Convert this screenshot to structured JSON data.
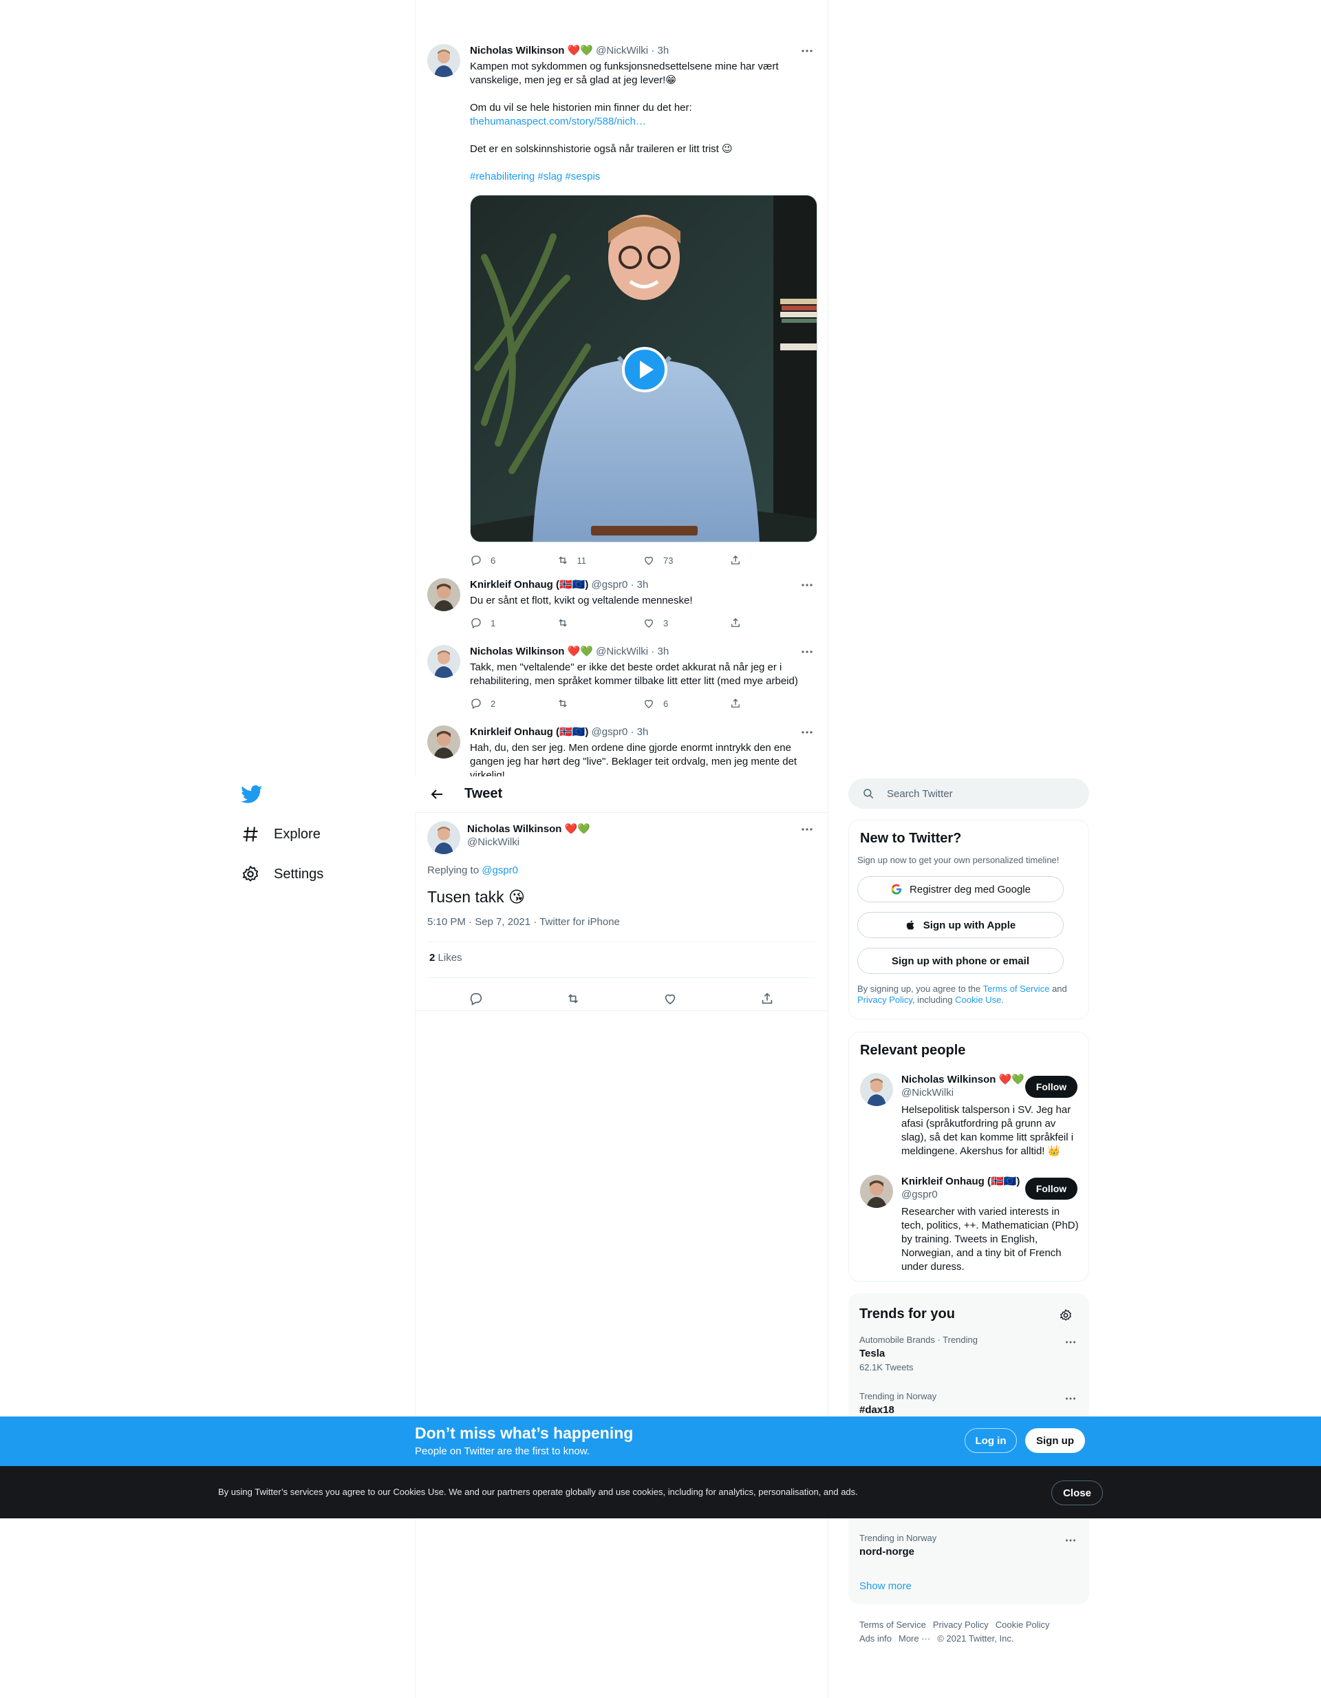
{
  "nav": {
    "explore_label": "Explore",
    "settings_label": "Settings"
  },
  "thread": [
    {
      "name": "Nicholas Wilkinson",
      "badges": "❤️💚",
      "handle": "@NickWilki",
      "time": "· 3h",
      "lines": [
        "Kampen mot sykdommen og funksjonsnedsettelsene mine har vært vanskelige, men jeg er så glad at jeg lever!😁",
        "Om du vil se hele historien min finner du det her:",
        "Det er en solskinnshistorie også når traileren er litt trist 😉"
      ],
      "link": "thehumanaspect.com/story/588/nich…",
      "hashtags": "#rehabilitering #slag #sespis",
      "replies": "6",
      "retweets": "11",
      "likes": "73"
    },
    {
      "name": "Knirkleif Onhaug (🇳🇴🇪🇺)",
      "handle": "@gspr0",
      "time": "· 3h",
      "text": "Du er sånt et flott, kvikt og veltalende menneske!",
      "replies": "1",
      "retweets": "",
      "likes": "3"
    },
    {
      "name": "Nicholas Wilkinson",
      "badges": "❤️💚",
      "handle": "@NickWilki",
      "time": "· 3h",
      "text": "Takk, men \"veltalende\" er ikke det beste ordet akkurat nå når jeg er i rehabilitering, men språket kommer tilbake litt etter litt (med mye arbeid)",
      "replies": "2",
      "retweets": "",
      "likes": "6"
    },
    {
      "name": "Knirkleif Onhaug (🇳🇴🇪🇺)",
      "handle": "@gspr0",
      "time": "· 3h",
      "text": "Hah, du, den ser jeg. Men ordene dine gjorde enormt inntrykk den ene gangen jeg har hørt deg \"live\". Beklager teit ordvalg, men jeg mente det virkelig!"
    }
  ],
  "header": {
    "title": "Tweet"
  },
  "main_tweet": {
    "name": "Nicholas Wilkinson",
    "badges": "❤️💚",
    "handle": "@NickWilki",
    "replying_prefix": "Replying to",
    "replying_to": "@gspr0",
    "text": "Tusen takk 😘",
    "meta": "5:10 PM · Sep 7, 2021 · Twitter for iPhone",
    "likes_count": "2",
    "likes_label": "Likes"
  },
  "search": {
    "placeholder": "Search Twitter"
  },
  "new_to_twitter": {
    "title": "New to Twitter?",
    "subtitle": "Sign up now to get your own personalized timeline!",
    "google_label": "Registrer deg med Google",
    "apple_label": "Sign up with Apple",
    "phone_label": "Sign up with phone or email",
    "legal_prefix": "By signing up, you agree to the",
    "terms": "Terms of Service",
    "and": "and",
    "privacy": "Privacy Policy",
    "including": ", including",
    "cookie": "Cookie Use."
  },
  "relevant_people": {
    "title": "Relevant people",
    "people": [
      {
        "name": "Nicholas Wilkinson ❤️💚",
        "handle": "@NickWilki",
        "bio": "Helsepolitisk talsperson i SV. Jeg har afasi (språkutfordring på grunn av slag), så det kan komme litt språkfeil i meldingene. Akershus for alltid! 👑",
        "follow_label": "Follow"
      },
      {
        "name": "Knirkleif Onhaug (🇳🇴🇪🇺)",
        "handle": "@gspr0",
        "bio": "Researcher with varied interests in tech, politics, ++. Mathematician (PhD) by training. Tweets in English, Norwegian, and a tiny bit of French under duress.",
        "follow_label": "Follow"
      }
    ]
  },
  "trends": {
    "title": "Trends for you",
    "items": [
      {
        "category": "Automobile Brands · Trending",
        "name": "Tesla",
        "count": "62.1K Tweets"
      },
      {
        "category": "Trending in Norway",
        "name": "#dax18",
        "count": ""
      },
      {
        "category": "Trending in Norway",
        "name": "nord-norge",
        "count": ""
      }
    ],
    "show_more": "Show more"
  },
  "footer": {
    "terms": "Terms of Service",
    "privacy": "Privacy Policy",
    "cookie": "Cookie Policy",
    "ads": "Ads info",
    "more": "More ···",
    "copyright": "© 2021 Twitter, Inc."
  },
  "bottom_bar": {
    "headline": "Don’t miss what’s happening",
    "sub": "People on Twitter are the first to know.",
    "login": "Log in",
    "signup": "Sign up"
  },
  "cookie_bar": {
    "text": "By using Twitter’s services you agree to our Cookies Use. We and our partners operate globally and use cookies, including for analytics, personalisation, and ads.",
    "close": "Close"
  },
  "colors": {
    "accent": "#1d9bf0",
    "text": "#0f1419",
    "muted": "#536471",
    "dark_bar": "#16181c"
  }
}
